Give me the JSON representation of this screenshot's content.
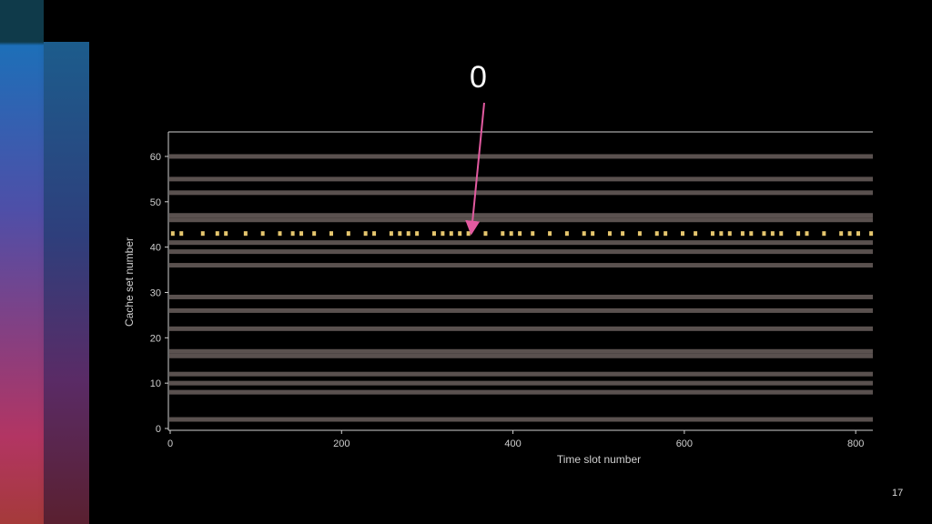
{
  "slide": {
    "annotation_label": "0",
    "page_number": "17",
    "colors": {
      "background": "#000000",
      "trace_band": "#5a514f",
      "highlight_dots": "#e5c66e",
      "arrow": "#e25aa0",
      "axis": "#cfcfcf"
    }
  },
  "chart_data": {
    "type": "scatter",
    "title": "",
    "xlabel": "Time slot number",
    "ylabel": "Cache set number",
    "xlim": [
      0,
      820
    ],
    "ylim": [
      0,
      63
    ],
    "xticks": [
      0,
      200,
      400,
      600,
      800
    ],
    "yticks": [
      0,
      10,
      20,
      30,
      40,
      50,
      60
    ],
    "busy_sets": [
      60,
      55,
      52,
      47,
      46,
      41,
      39,
      36,
      29,
      26,
      22,
      17,
      16,
      12,
      10,
      8,
      2
    ],
    "highlight_set": 43,
    "highlight_series_x": [
      3,
      13,
      38,
      55,
      65,
      88,
      108,
      128,
      143,
      153,
      168,
      188,
      208,
      228,
      238,
      258,
      268,
      278,
      288,
      308,
      318,
      328,
      338,
      348,
      368,
      388,
      398,
      408,
      423,
      443,
      463,
      483,
      493,
      513,
      528,
      548,
      568,
      578,
      598,
      613,
      633,
      643,
      653,
      668,
      678,
      693,
      703,
      713,
      733,
      743,
      763,
      783,
      793,
      803,
      818
    ],
    "annotation_arrow_target": [
      352,
      43
    ]
  }
}
